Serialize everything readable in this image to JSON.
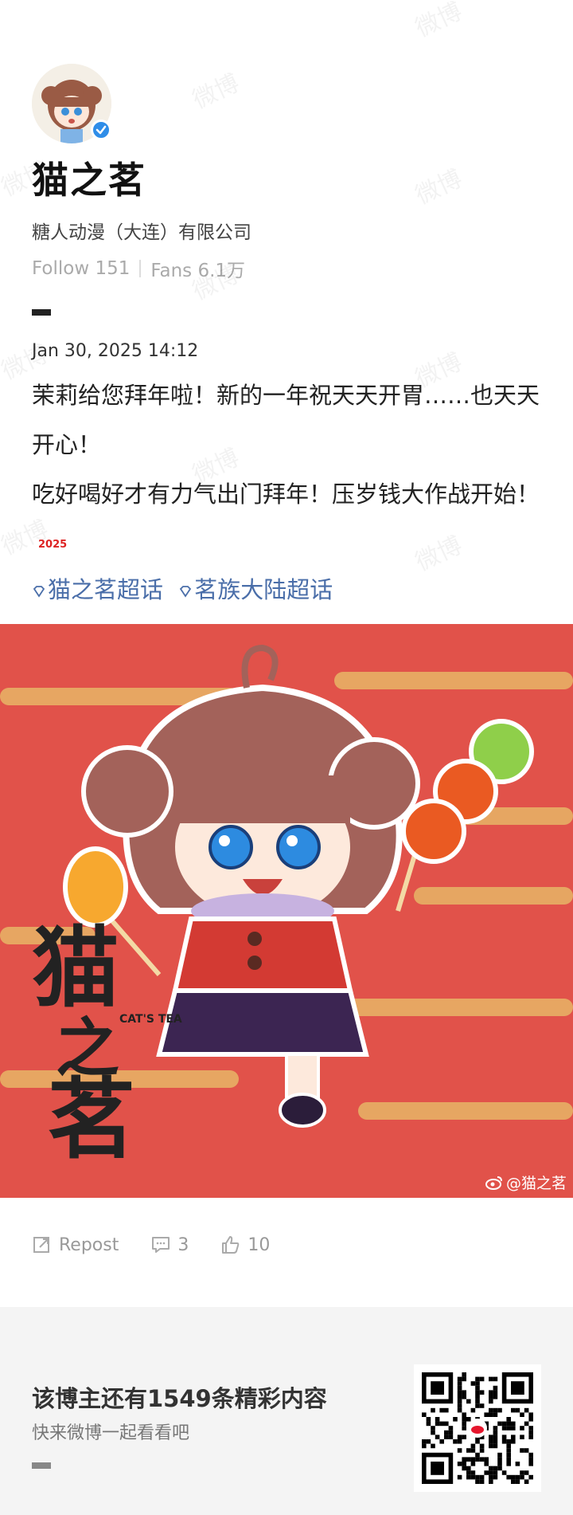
{
  "profile": {
    "name": "猫之茗",
    "company": "糖人动漫（大连）有限公司",
    "follow_text": "Follow 151",
    "fans_text": "Fans 6.1万"
  },
  "post": {
    "time": "Jan 30, 2025 14:12",
    "text_line1": "茉莉给您拜年啦！新的一年祝天天开胃……也天天开心！",
    "text_line2": "吃好喝好才有力气出门拜年！压岁钱大作战开始！",
    "emoji_badge": "2025",
    "topics": [
      "猫之茗超话",
      "茗族大陆超话"
    ],
    "image_credit": "@猫之茗",
    "image_logo_lines": [
      "猫",
      "之",
      "茗"
    ],
    "image_logo_small": "CAT'S TEA"
  },
  "actions": {
    "repost_label": "Repost",
    "comment_count": "3",
    "like_count": "10"
  },
  "footer": {
    "title": "该博主还有1549条精彩内容",
    "subtitle": "快来微博一起看看吧"
  },
  "watermark_text": "微博",
  "colors": {
    "topic_blue": "#4a6ea9",
    "image_bg_red": "#e1524a",
    "verified_blue": "#2f8de8"
  },
  "icons": [
    "verified-icon",
    "diamond-icon",
    "repost-icon",
    "comment-icon",
    "like-icon",
    "weibo-logo-icon",
    "qr-code"
  ]
}
